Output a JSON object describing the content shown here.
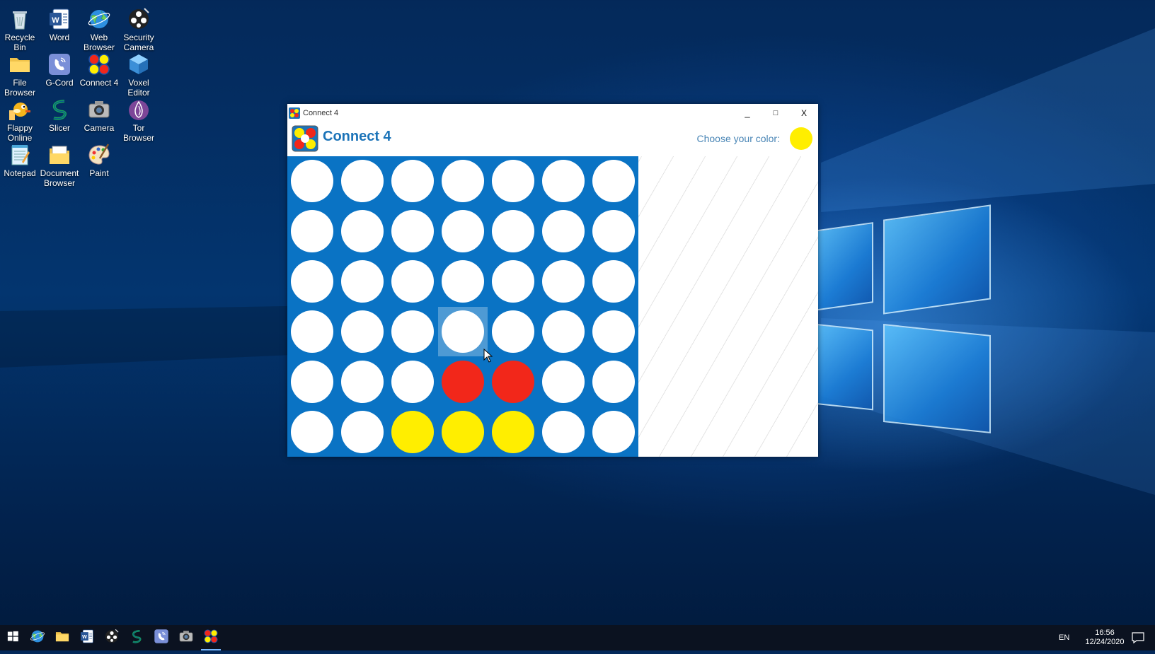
{
  "desktop": {
    "icons": [
      {
        "label": "Recycle Bin",
        "icon": "recycle-bin-icon"
      },
      {
        "label": "Word",
        "icon": "word-icon"
      },
      {
        "label": "Web Browser",
        "icon": "web-browser-icon"
      },
      {
        "label": "Security Camera",
        "icon": "security-camera-icon"
      },
      {
        "label": "File Browser",
        "icon": "folder-icon"
      },
      {
        "label": "G-Cord",
        "icon": "g-cord-icon"
      },
      {
        "label": "Connect 4",
        "icon": "connect4-icon"
      },
      {
        "label": "Voxel Editor",
        "icon": "voxel-cube-icon"
      },
      {
        "label": "Flappy Online",
        "icon": "flappy-bird-icon"
      },
      {
        "label": "Slicer",
        "icon": "slicer-icon"
      },
      {
        "label": "Camera",
        "icon": "camera-icon"
      },
      {
        "label": "Tor Browser",
        "icon": "tor-onion-icon"
      },
      {
        "label": "Notepad",
        "icon": "notepad-icon"
      },
      {
        "label": "Document Browser",
        "icon": "document-folder-icon"
      },
      {
        "label": "Paint",
        "icon": "paint-palette-icon"
      }
    ]
  },
  "window": {
    "title": "Connect 4",
    "minimize": "_",
    "maximize": "□",
    "close": "X",
    "app_title": "Connect 4",
    "choose_color_label": "Choose your color:",
    "chosen_color": "#ffee00"
  },
  "board": {
    "rows": 6,
    "cols": 7,
    "hover_column": 3,
    "hover_row": 3,
    "cells": [
      [
        "empty",
        "empty",
        "empty",
        "empty",
        "empty",
        "empty",
        "empty"
      ],
      [
        "empty",
        "empty",
        "empty",
        "empty",
        "empty",
        "empty",
        "empty"
      ],
      [
        "empty",
        "empty",
        "empty",
        "empty",
        "empty",
        "empty",
        "empty"
      ],
      [
        "empty",
        "empty",
        "empty",
        "empty",
        "empty",
        "empty",
        "empty"
      ],
      [
        "empty",
        "empty",
        "empty",
        "red",
        "red",
        "empty",
        "empty"
      ],
      [
        "empty",
        "empty",
        "yellow",
        "yellow",
        "yellow",
        "empty",
        "empty"
      ]
    ],
    "colors": {
      "empty": "#ffffff",
      "red": "#f2271a",
      "yellow": "#ffee00",
      "board": "#0a73c4"
    }
  },
  "taskbar": {
    "apps": [
      "start-icon",
      "web-browser-icon",
      "folder-icon",
      "word-icon",
      "security-camera-icon",
      "slicer-icon",
      "g-cord-icon",
      "camera-icon",
      "connect4-icon"
    ],
    "active_app": "connect4-icon",
    "language": "EN",
    "time": "16:56",
    "date": "12/24/2020"
  }
}
